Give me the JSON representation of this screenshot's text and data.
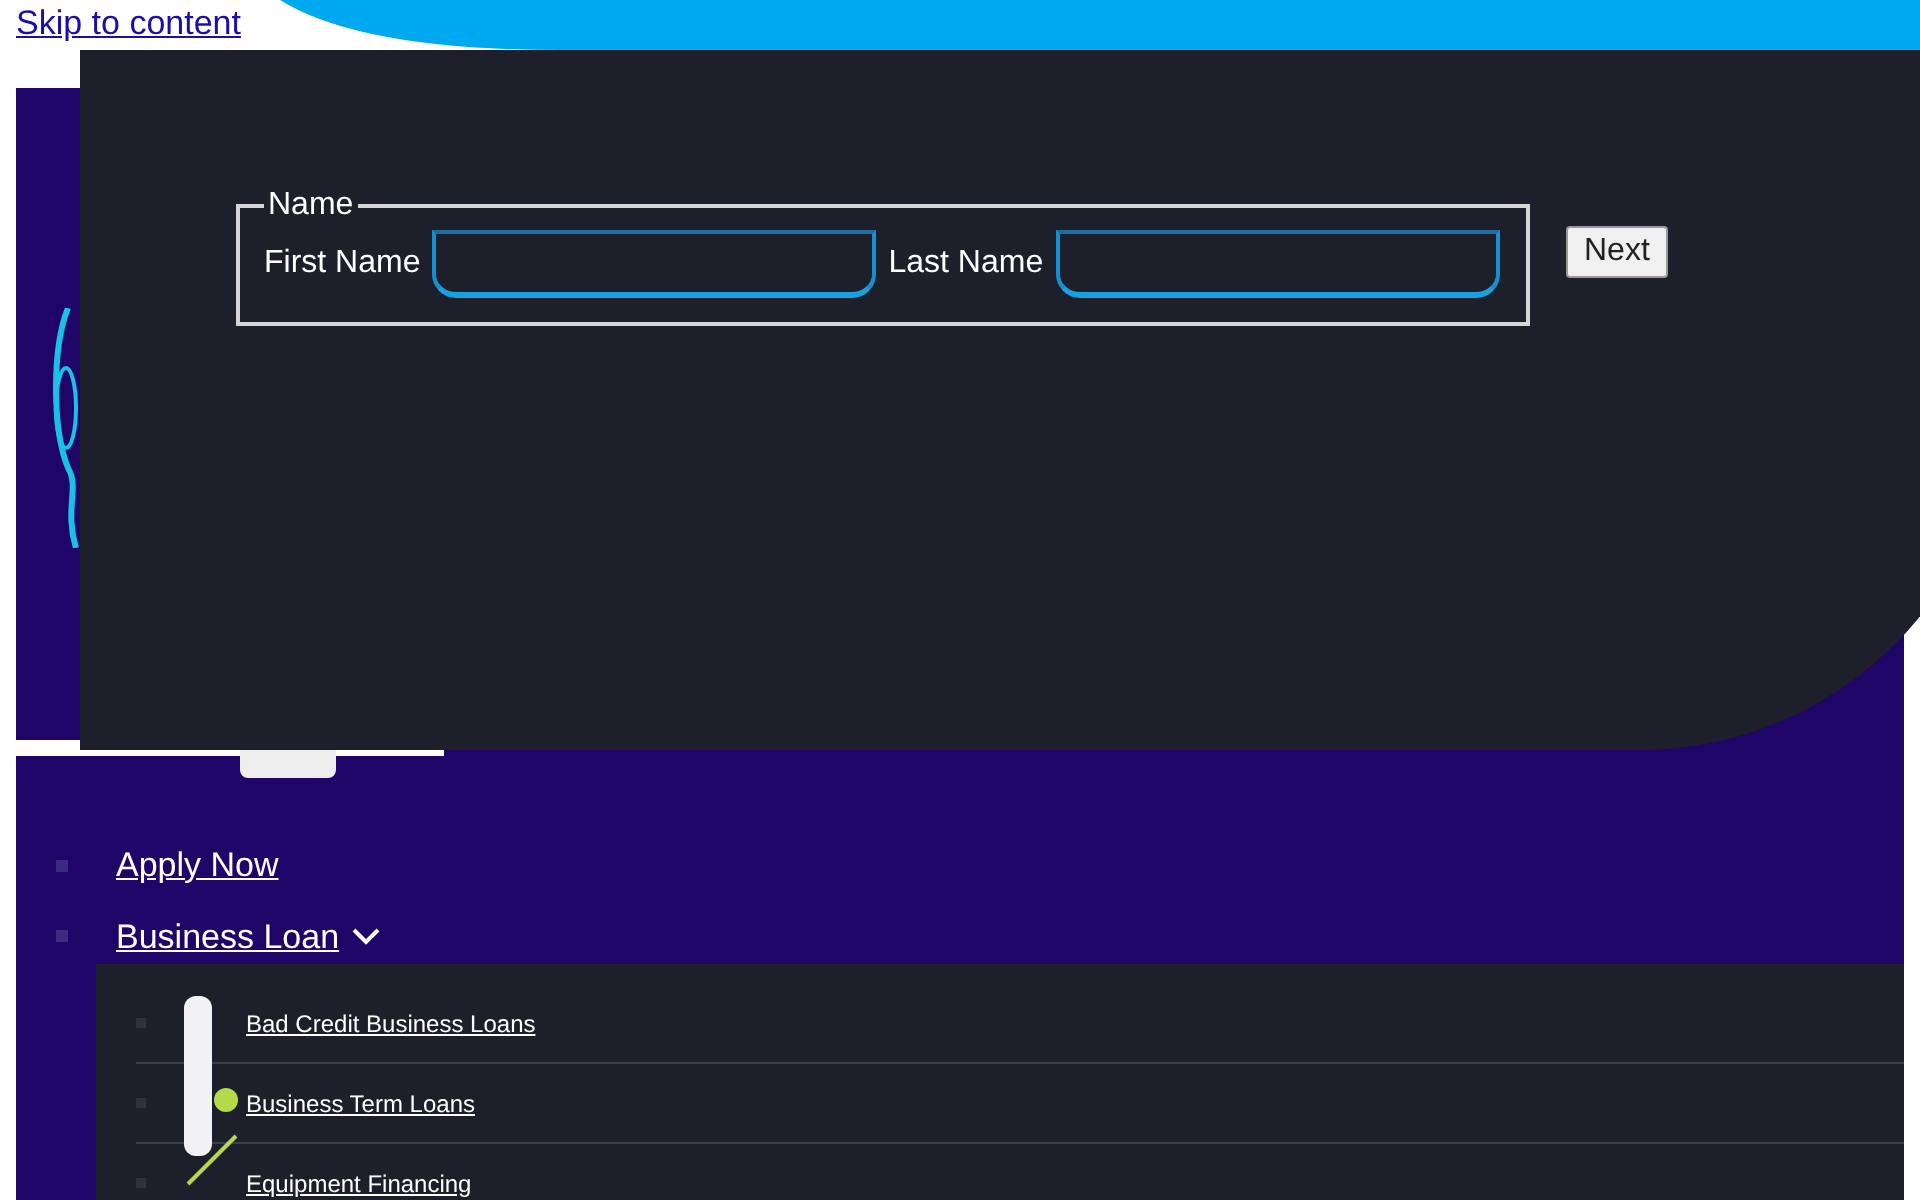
{
  "skip_link": "Skip to content",
  "dialog": {
    "fieldset": {
      "legend": "Name",
      "fields": [
        {
          "label": "First Name"
        },
        {
          "label": "Last Name"
        }
      ]
    },
    "button": "Next"
  },
  "nav": {
    "items": [
      {
        "label": "Apply Now",
        "has_submenu": false
      },
      {
        "label": "Business Loan",
        "has_submenu": true
      }
    ],
    "submenu": [
      {
        "label": "Bad Credit Business Loans"
      },
      {
        "label": "Business Term Loans"
      },
      {
        "label": "Equipment Financing"
      }
    ]
  }
}
